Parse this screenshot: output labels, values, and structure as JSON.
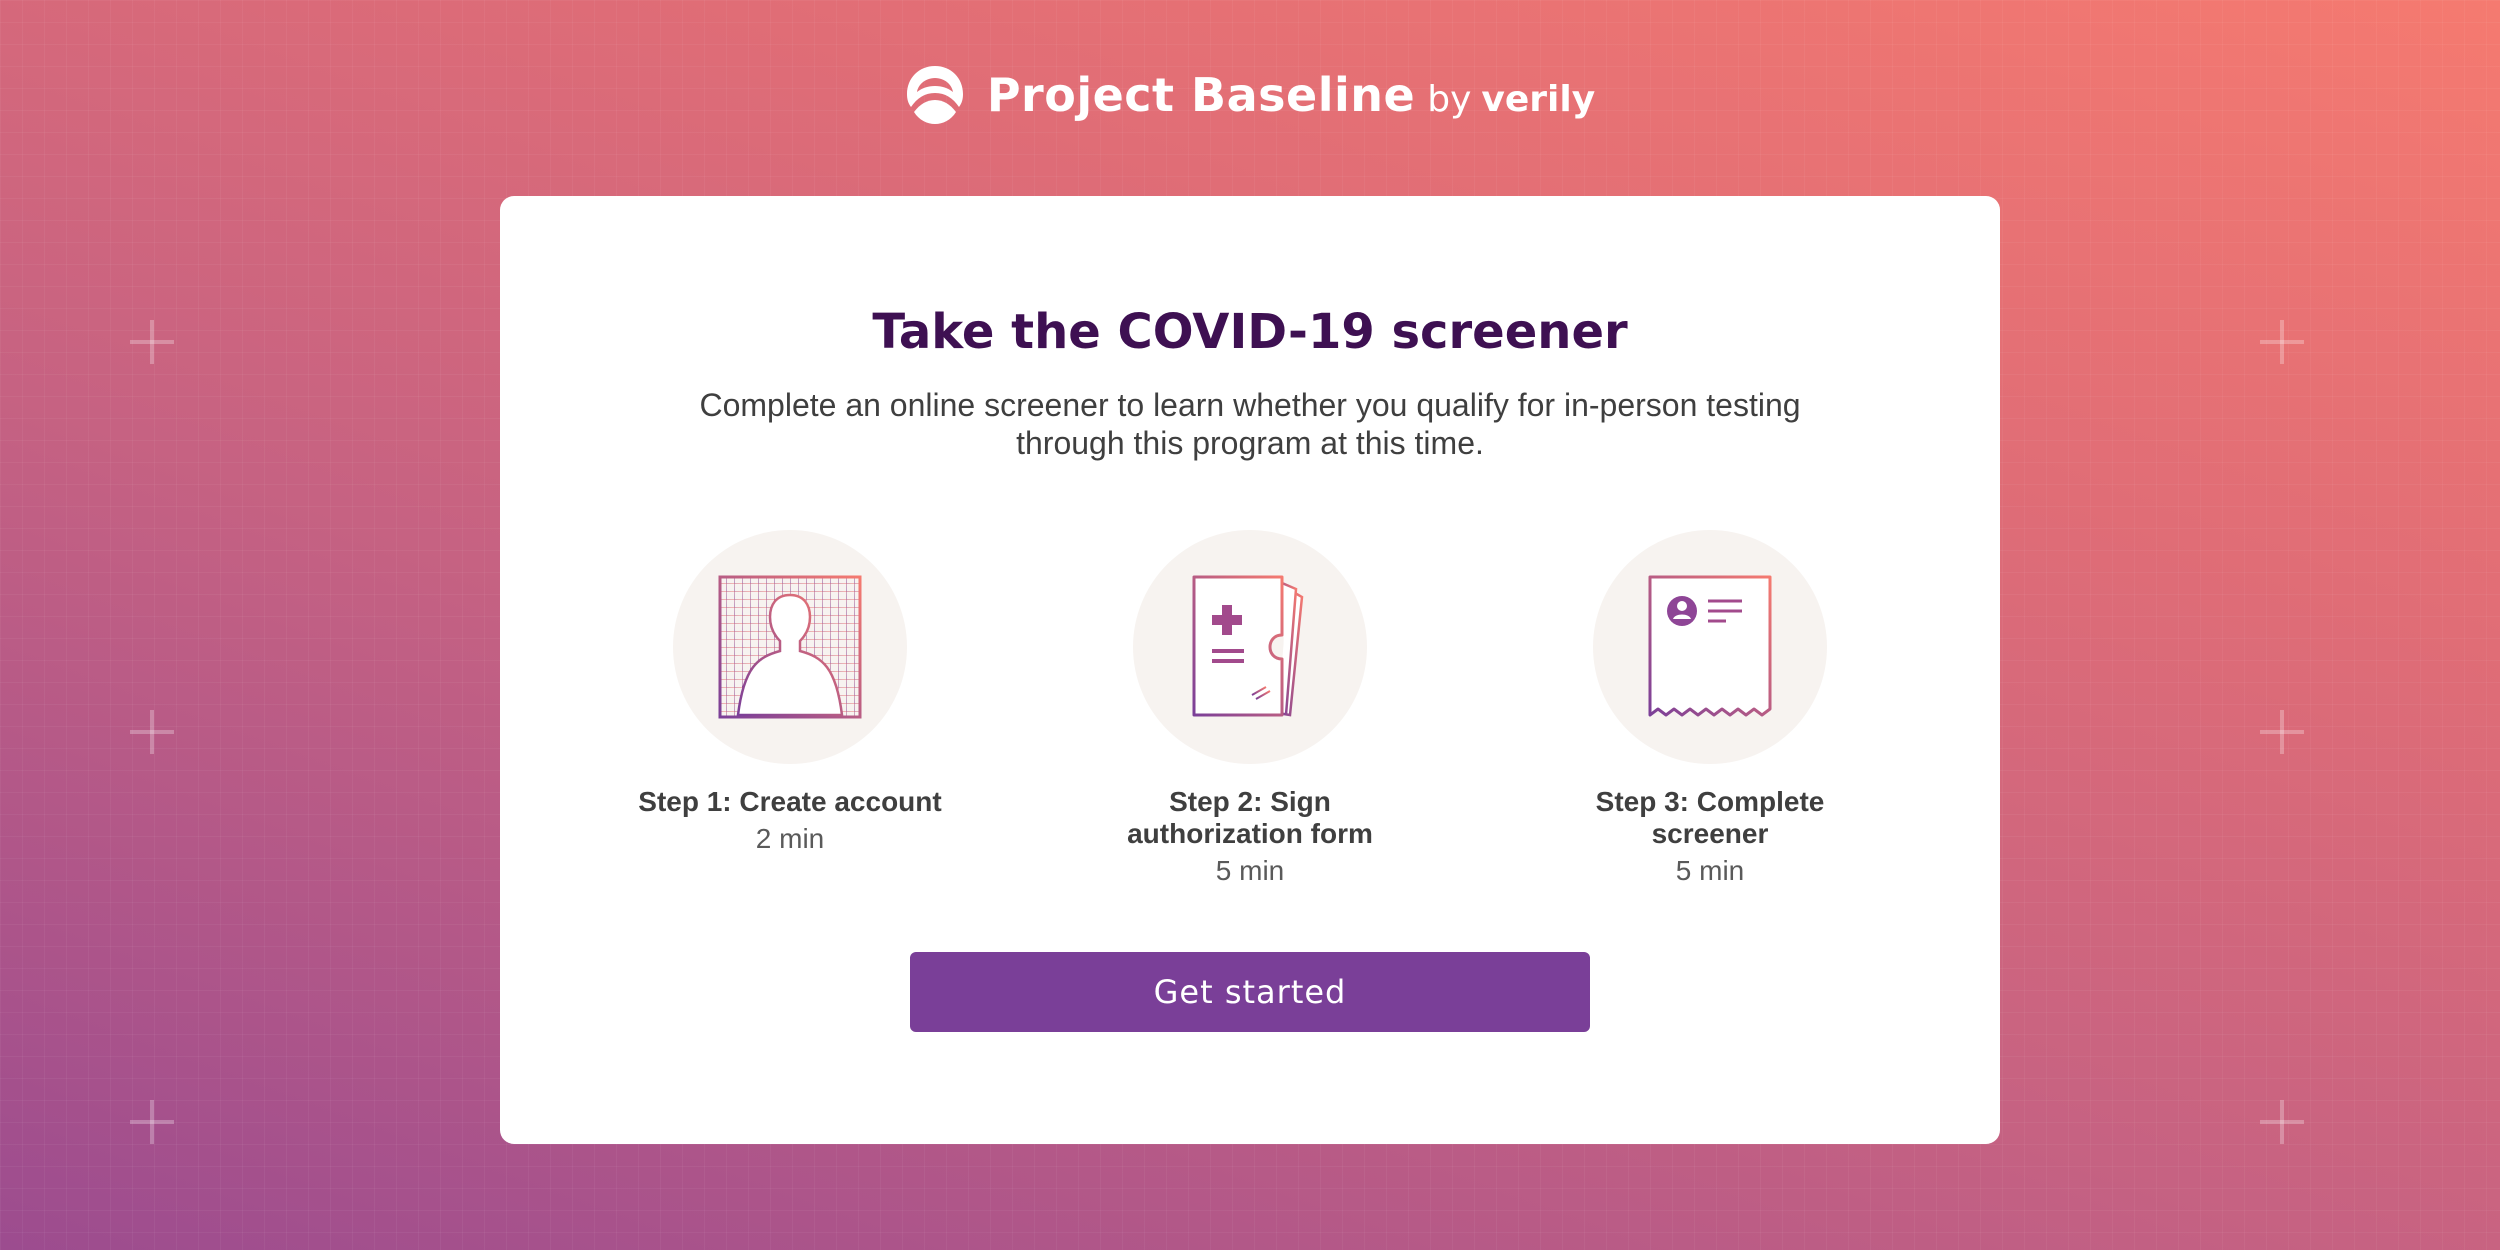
{
  "brand": {
    "name": "Project Baseline",
    "by": "by",
    "company": "verily",
    "logo_icon": "baseline-logo-icon"
  },
  "card": {
    "title": "Take the COVID-19 screener",
    "subtitle": "Complete an online screener to learn whether you qualify for in-person testing through this program at this time."
  },
  "steps": [
    {
      "label": "Step 1: Create account",
      "time": "2 min",
      "icon": "account-portrait-icon"
    },
    {
      "label": "Step 2: Sign authorization form",
      "time": "5 min",
      "icon": "authorization-form-icon"
    },
    {
      "label": "Step 3: Complete screener",
      "time": "5 min",
      "icon": "screener-document-icon"
    }
  ],
  "cta": {
    "label": "Get started"
  },
  "colors": {
    "title": "#3e1052",
    "button": "#7a3f98",
    "background_start": "#f57a70",
    "background_end": "#9c4c8f",
    "icon_gradient_start": "#7b3f98",
    "icon_gradient_end": "#f57a70"
  }
}
